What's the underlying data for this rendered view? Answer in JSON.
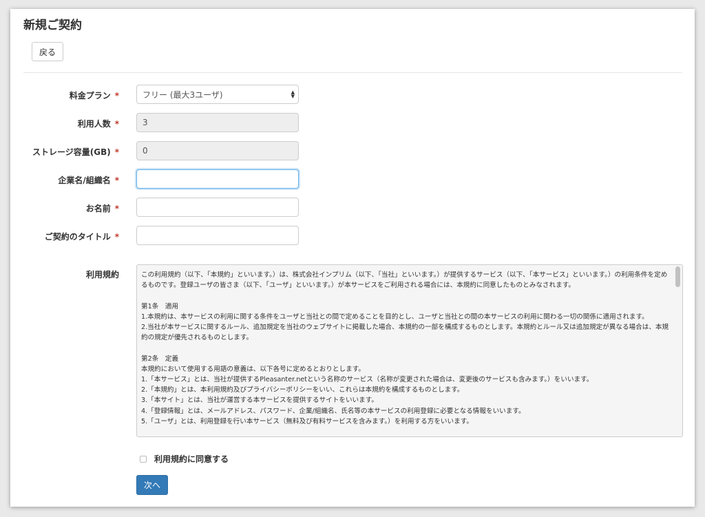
{
  "page": {
    "title": "新規ご契約"
  },
  "buttons": {
    "back": "戻る",
    "next": "次へ"
  },
  "required_mark": "*",
  "form": {
    "plan": {
      "label": "料金プラン",
      "value": "フリー (最大3ユーザ)"
    },
    "users": {
      "label": "利用人数",
      "value": "3"
    },
    "storage": {
      "label": "ストレージ容量(GB)",
      "value": "0"
    },
    "company": {
      "label": "企業名/組織名",
      "value": ""
    },
    "name": {
      "label": "お名前",
      "value": ""
    },
    "contract_title": {
      "label": "ご契約のタイトル",
      "value": ""
    },
    "terms": {
      "label": "利用規約",
      "text": "この利用規約（以下、「本規約」といいます。）は、株式会社インプリム（以下、「当社」といいます。）が提供するサービス（以下、「本サービス」といいます。）の利用条件を定めるものです。登録ユーザの皆さま（以下、「ユーザ」といいます。）が本サービスをご利用される場合には、本規約に同意したものとみなされます。\n\n第1条　適用\n1.本規約は、本サービスの利用に関する条件をユーザと当社との間で定めることを目的とし、ユーザと当社との間の本サービスの利用に関わる一切の関係に適用されます。\n2.当社が本サービスに関するルール、追加規定を当社のウェブサイトに掲載した場合、本規約の一部を構成するものとします。本規約とルール又は追加規定が異なる場合は、本規約の規定が優先されるものとします。\n\n第2条　定義\n本規約において使用する用語の意義は、以下各号に定めるとおりとします。\n1.「本サービス」とは、当社が提供するPleasanter.netという名称のサービス（名称が変更された場合は、変更後のサービスも含みます。）をいいます。\n2.「本規約」とは、本利用規約及びプライバシーポリシーをいい、これらは本規約を構成するものとします。\n3.「本サイト」とは、当社が運営する本サービスを提供するサイトをいいます。\n4.「登録情報」とは、メールアドレス、パスワード、企業/組織名、氏名等の本サービスの利用登録に必要となる情報をいいます。\n5.「ユーザ」とは、利用登録を行い本サービス（無料及び有料サービスを含みます。）を利用する方をいいます。",
      "agree_label": "利用規約に同意する",
      "agreed": false
    }
  }
}
